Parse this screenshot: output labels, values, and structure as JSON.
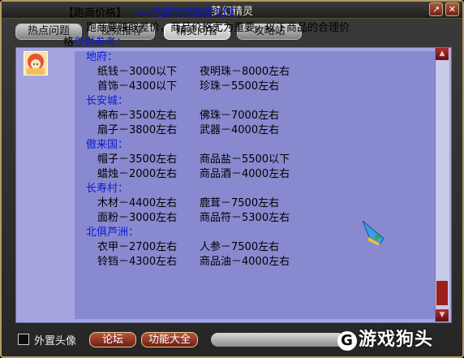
{
  "window": {
    "title": "梦幻精灵"
  },
  "tabs": [
    {
      "label": "热点问题"
    },
    {
      "label": "视频推荐"
    },
    {
      "label": "精灵问答"
    },
    {
      "label": "攻略站"
    }
  ],
  "article": {
    "heading": "【跑商价格】",
    "link": ">>跑商价格刷新时间",
    "intro1": "跑商要赚取差价，商品价格尤为重要，以下商品的合理价",
    "intro2_prefix": "格",
    "intro2_blue": "仅供参考：",
    "regions": [
      {
        "name": "地府：",
        "rows": [
          [
            "纸钱－3000以下",
            "夜明珠－8000左右"
          ],
          [
            "首饰－4300以下",
            "珍珠－5500左右"
          ]
        ]
      },
      {
        "name": "长安城：",
        "rows": [
          [
            "棉布－3500左右",
            "佛珠－7000左右"
          ],
          [
            "扇子－3800左右",
            "武器－4000左右"
          ]
        ]
      },
      {
        "name": "傲来国：",
        "rows": [
          [
            "帽子－3500左右",
            "商品盐－5500以下"
          ],
          [
            "蜡烛－2000左右",
            "商品酒－4000左右"
          ]
        ]
      },
      {
        "name": "长寿村：",
        "rows": [
          [
            "木材－4400左右",
            "鹿茸－7500左右"
          ],
          [
            "面粉－3000左右",
            "商品符－5300左右"
          ]
        ]
      },
      {
        "name": "北俱芦洲：",
        "rows": [
          [
            "衣甲－2700左右",
            "人参－7500左右"
          ],
          [
            "铃铛－4300左右",
            "商品油－4000左右"
          ]
        ]
      }
    ]
  },
  "bottom": {
    "avatar_checkbox_label": "外置头像",
    "forum_button": "论坛",
    "functions_button": "功能大全",
    "watermark": "游戏狗头"
  },
  "colors": {
    "accent_blue": "#0a1ad8",
    "panel_bg": "#8989cf",
    "button_red": "#8b2e1f"
  }
}
